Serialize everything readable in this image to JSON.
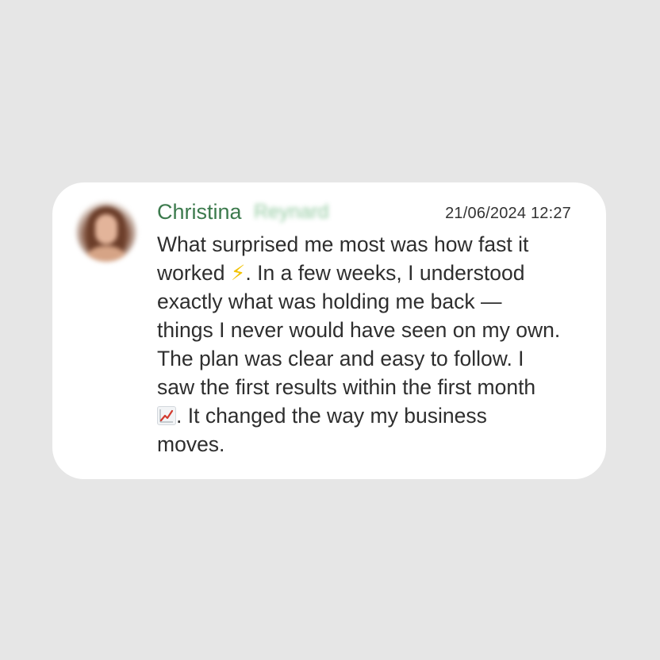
{
  "review": {
    "first_name": "Christina",
    "last_name": "Reynard",
    "timestamp": "21/06/2024 12:27",
    "text_part1": "What surprised me most was how fast it\nworked ",
    "emoji1": "⚡",
    "text_part2": ". In a few weeks, I understood\nexactly what was holding me back —\nthings I never would have seen on my own.\nThe plan was clear and easy to follow. I\nsaw the first results within the first month\n",
    "emoji2_icon": "chart-increasing-icon",
    "text_part3": ". It changed the way my business\nmoves."
  },
  "colors": {
    "background": "#e6e6e6",
    "card": "#ffffff",
    "name": "#3c7a4d",
    "text": "#2e2e2e"
  }
}
